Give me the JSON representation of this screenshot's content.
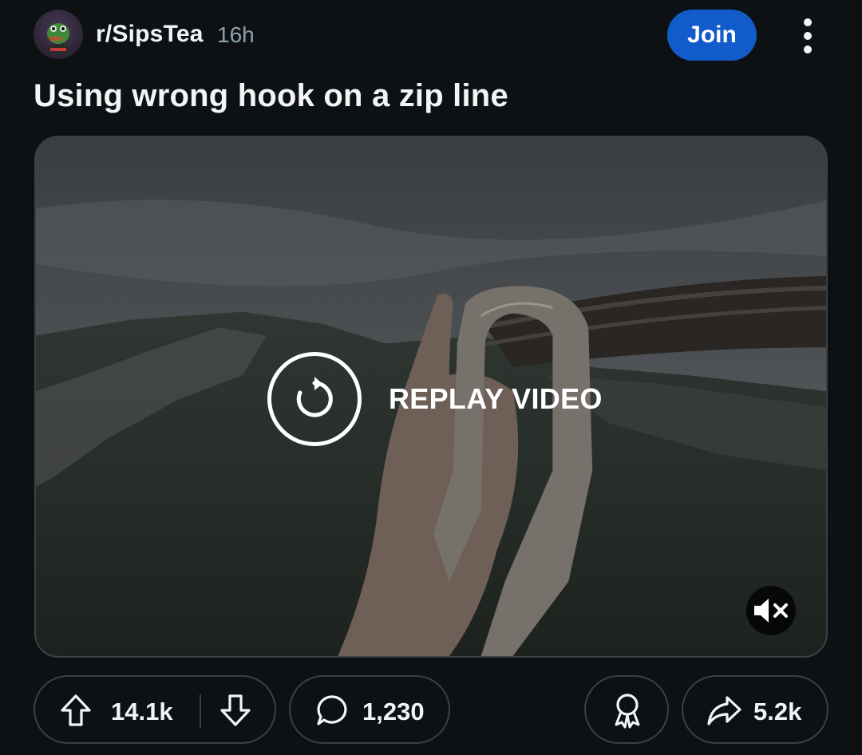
{
  "post": {
    "subreddit": "r/SipsTea",
    "age": "16h",
    "join_label": "Join",
    "title": "Using wrong hook on a zip line"
  },
  "video": {
    "replay_label": "REPLAY VIDEO",
    "muted": true
  },
  "actions": {
    "upvotes": "14.1k",
    "comments": "1,230",
    "shares": "5.2k"
  },
  "colors": {
    "background": "#0e1113",
    "join_button": "#115bca",
    "muted_text": "#8ba2ad",
    "pill_border": "#3a4045"
  },
  "icons": [
    "overflow-menu-icon",
    "replay-icon",
    "mute-icon",
    "upvote-icon",
    "downvote-icon",
    "comment-icon",
    "award-icon",
    "share-icon"
  ]
}
